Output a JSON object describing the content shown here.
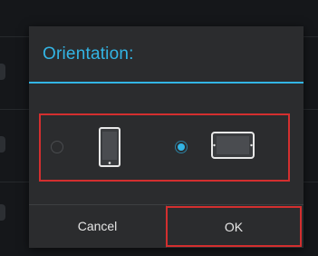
{
  "dialog": {
    "title": "Orientation:",
    "accent_color": "#33b5e5",
    "options": [
      {
        "icon": "phone-portrait-icon",
        "selected": false
      },
      {
        "icon": "tablet-landscape-icon",
        "selected": true
      }
    ],
    "buttons": {
      "cancel_label": "Cancel",
      "ok_label": "OK"
    },
    "highlight_color": "#d32f2f"
  }
}
